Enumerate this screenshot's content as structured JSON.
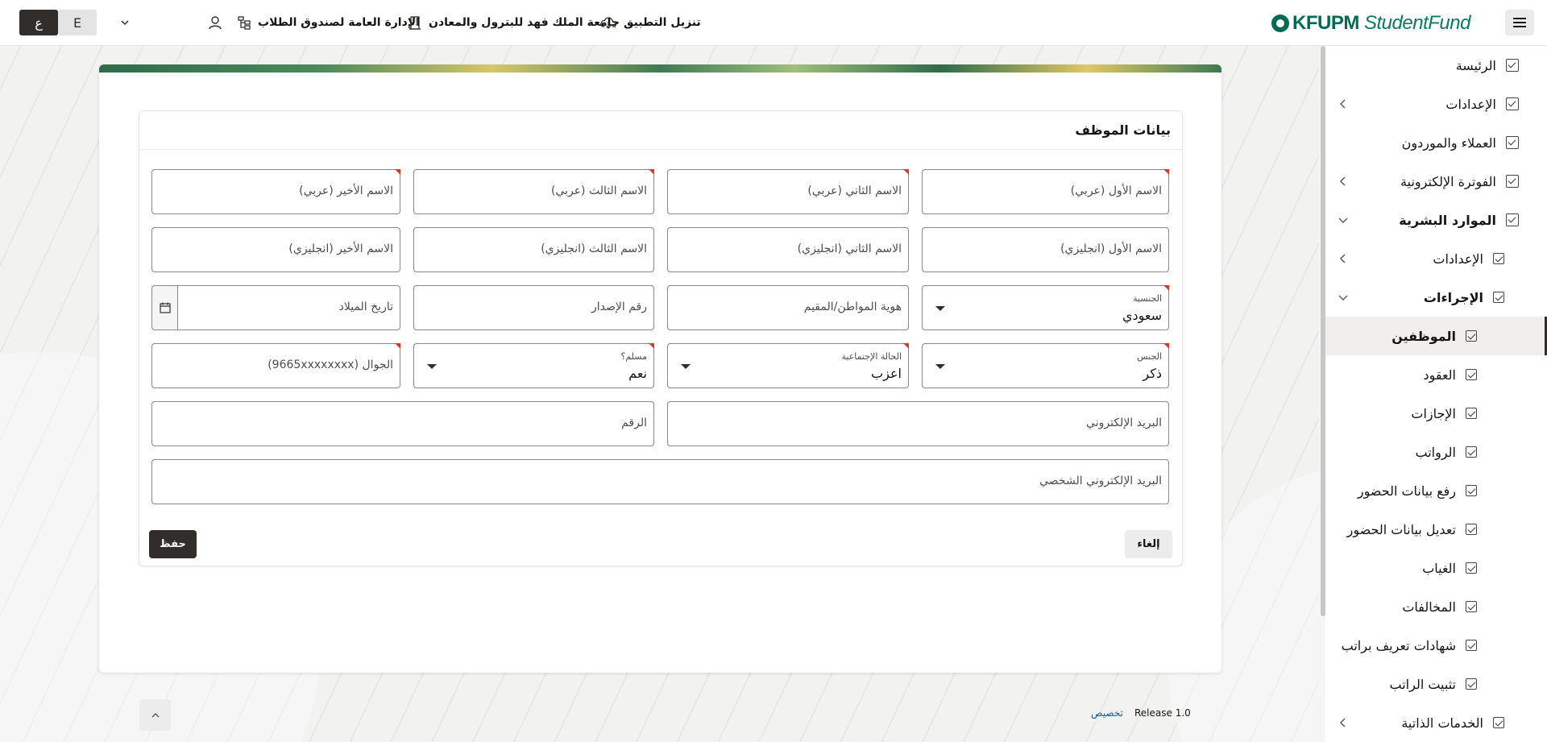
{
  "header": {
    "lang_ar": "ع",
    "lang_en": "E",
    "user_dept": "الإدارة العامة لصندوق الطلاب",
    "university": "جامعة الملك فهد للبترول والمعادن",
    "download_app": "تنزيل التطبيق",
    "logo_main": "KFUPM",
    "logo_sub": "StudentFund",
    "icons": {
      "user": "user-icon",
      "org": "org-chart-icon",
      "building": "building-icon",
      "download": "cloud-download-icon",
      "menu": "hamburger-menu-icon"
    }
  },
  "sidebar": {
    "items": [
      {
        "label": "الرئيسة",
        "chevron": false,
        "bold": false,
        "level": 0
      },
      {
        "label": "الإعدادات",
        "chevron": true,
        "bold": false,
        "level": 0
      },
      {
        "label": "العملاء والموردون",
        "chevron": false,
        "bold": false,
        "level": 0
      },
      {
        "label": "الفوترة الإلكترونية",
        "chevron": true,
        "bold": false,
        "level": 0
      },
      {
        "label": "الموارد البشرية",
        "chevron": "down",
        "bold": true,
        "level": 0
      },
      {
        "label": "الإعدادات",
        "chevron": true,
        "bold": false,
        "level": 1
      },
      {
        "label": "الإجراءات",
        "chevron": "down",
        "bold": true,
        "level": 1
      },
      {
        "label": "الموظفين",
        "chevron": false,
        "bold": true,
        "level": 2,
        "selected": true
      },
      {
        "label": "العقود",
        "chevron": false,
        "bold": false,
        "level": 2
      },
      {
        "label": "الإجازات",
        "chevron": false,
        "bold": false,
        "level": 2
      },
      {
        "label": "الرواتب",
        "chevron": false,
        "bold": false,
        "level": 2
      },
      {
        "label": "رفع بيانات الحضور",
        "chevron": false,
        "bold": false,
        "level": 2
      },
      {
        "label": "تعديل بيانات الحضور",
        "chevron": false,
        "bold": false,
        "level": 2
      },
      {
        "label": "الغياب",
        "chevron": false,
        "bold": false,
        "level": 2
      },
      {
        "label": "المخالفات",
        "chevron": false,
        "bold": false,
        "level": 2
      },
      {
        "label": "شهادات تعريف براتب",
        "chevron": false,
        "bold": false,
        "level": 2
      },
      {
        "label": "تثبيت الراتب",
        "chevron": false,
        "bold": false,
        "level": 2
      },
      {
        "label": "الخدمات الذاتية",
        "chevron": true,
        "bold": false,
        "level": 1
      }
    ]
  },
  "form": {
    "title": "بيانات الموظف",
    "first_name_ar": "الاسم الأول (عربي)",
    "second_name_ar": "الاسم الثاني (عربي)",
    "third_name_ar": "الاسم الثالث (عربي)",
    "last_name_ar": "الاسم الأخير (عربي)",
    "first_name_en": "الاسم الأول (انجليزي)",
    "second_name_en": "الاسم الثاني (انجليزي)",
    "third_name_en": "الاسم الثالث (انجليزي)",
    "last_name_en": "الاسم الأخير (انجليزي)",
    "nationality_label": "الجنسية",
    "nationality_value": "سعودي",
    "national_id": "هوية المواطن/المقيم",
    "issue_number": "رقم الإصدار",
    "birth_date": "تاريخ الميلاد",
    "gender_label": "الجنس",
    "gender_value": "ذكر",
    "marital_label": "الحالة الإجتماعية",
    "marital_value": "اعزب",
    "muslim_label": "مسلم؟",
    "muslim_value": "نعم",
    "mobile": "الجوال (9665xxxxxxxx)",
    "email": "البريد الإلكتروني",
    "number": "الرقم",
    "personal_email": "البريد الإلكتروني الشخصي",
    "cancel": "إلغاء",
    "save": "حفظ"
  },
  "footer": {
    "release": "Release 1.0",
    "customize": "تخصيص"
  }
}
